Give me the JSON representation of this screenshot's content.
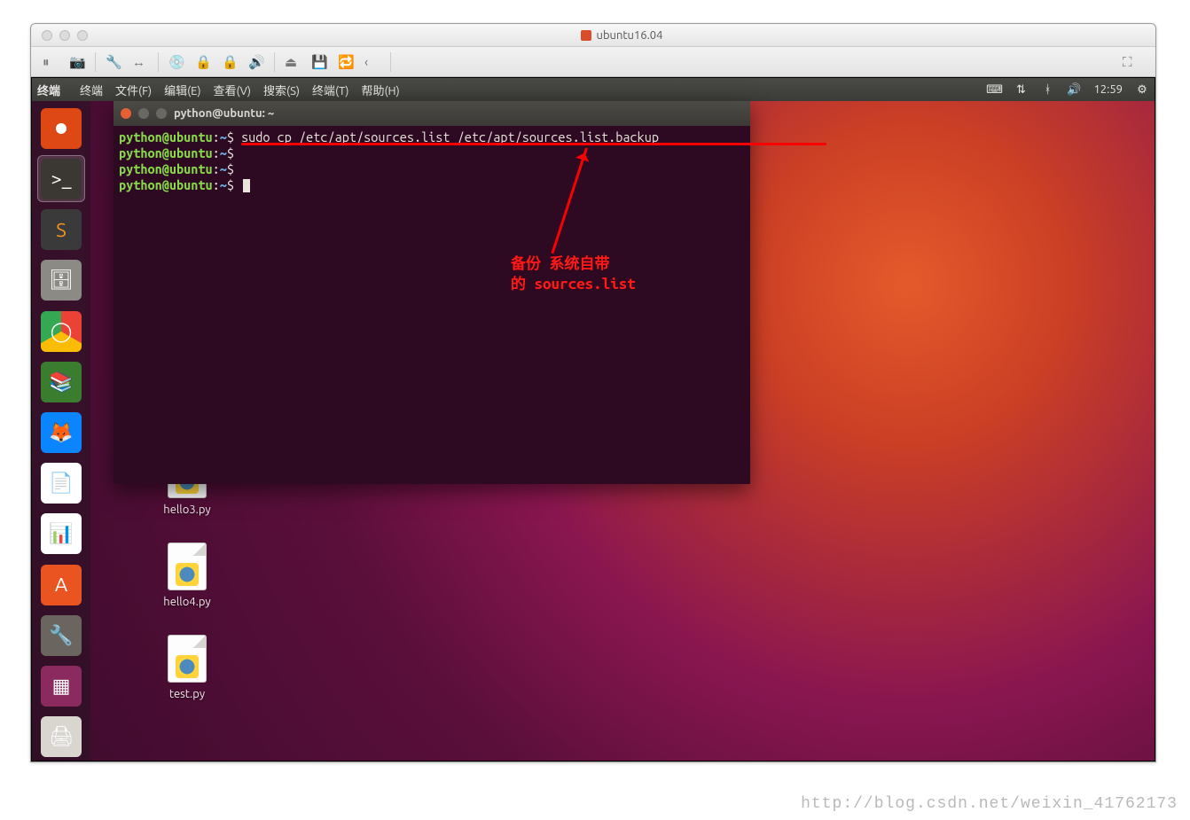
{
  "host": {
    "title": "ubuntu16.04",
    "toolbar": {
      "pause": "⏸",
      "snapshots": "📷",
      "settings": "🔧",
      "arrows-lr": "↔",
      "disk": "💿",
      "lock1": "🔒",
      "lock2": "🔒",
      "sound": "🔊",
      "usb": "⏏",
      "save": "💾",
      "share": "🔁",
      "chev": "‹",
      "fullscreen": "⛶"
    }
  },
  "ubuntu_panel": {
    "app": "终端",
    "menus": [
      "终端",
      "文件(F)",
      "编辑(E)",
      "查看(V)",
      "搜索(S)",
      "终端(T)",
      "帮助(H)"
    ],
    "time": "12:59"
  },
  "launcher": [
    {
      "name": "dash",
      "color": "#dd4814",
      "glyph": "◉"
    },
    {
      "name": "terminal",
      "color": "#3b3732",
      "glyph": ">_",
      "active": true
    },
    {
      "name": "sublime",
      "color": "#3a3a3a",
      "glyph": "S"
    },
    {
      "name": "files",
      "color": "#8c8a84",
      "glyph": "🗄"
    },
    {
      "name": "chrome",
      "color": "#ffffff",
      "glyph": "◯"
    },
    {
      "name": "books",
      "color": "#3a7d2f",
      "glyph": "📚"
    },
    {
      "name": "firefox",
      "color": "#0a84ff",
      "glyph": "🦊"
    },
    {
      "name": "writer",
      "color": "#ffffff",
      "glyph": "📄"
    },
    {
      "name": "calc",
      "color": "#ffffff",
      "glyph": "📊"
    },
    {
      "name": "software",
      "color": "#e95420",
      "glyph": "A"
    },
    {
      "name": "settings",
      "color": "#6b6560",
      "glyph": "🔧"
    },
    {
      "name": "workspace",
      "color": "#8a2a5f",
      "glyph": "▦"
    },
    {
      "name": "printer",
      "color": "#d9d6d0",
      "glyph": "🖨"
    }
  ],
  "terminal": {
    "title": "python@ubuntu: ~",
    "prompt_user": "python@ubuntu",
    "prompt_sep": ":",
    "prompt_path": "~",
    "prompt_sym": "$",
    "lines": [
      {
        "cmd": "sudo cp /etc/apt/sources.list /etc/apt/sources.list.backup"
      },
      {
        "cmd": ""
      },
      {
        "cmd": ""
      },
      {
        "cmd": "",
        "cursor": true
      }
    ]
  },
  "desktop_files": [
    {
      "name": "hello3.py"
    },
    {
      "name": "hello4.py"
    },
    {
      "name": "test.py"
    }
  ],
  "annotation": {
    "line1": "备份 系统自带",
    "line2": "的 sources.list"
  },
  "watermark": "http://blog.csdn.net/weixin_41762173"
}
